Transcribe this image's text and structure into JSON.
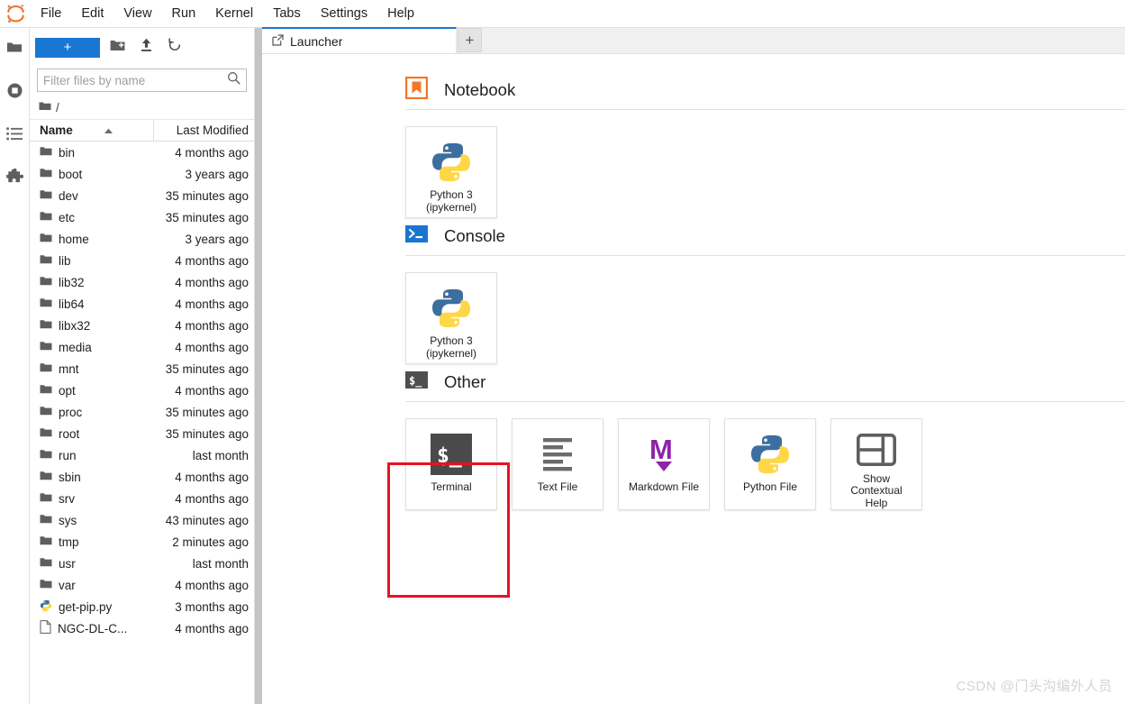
{
  "menubar": {
    "logo_icon": "jupyter-logo",
    "items": [
      {
        "label": "File"
      },
      {
        "label": "Edit"
      },
      {
        "label": "View"
      },
      {
        "label": "Run"
      },
      {
        "label": "Kernel"
      },
      {
        "label": "Tabs"
      },
      {
        "label": "Settings"
      },
      {
        "label": "Help"
      }
    ]
  },
  "activitybar": {
    "items": [
      {
        "name": "file-browser-icon",
        "label": "File Browser"
      },
      {
        "name": "running-terminals-icon",
        "label": "Running Terminals and Kernels"
      },
      {
        "name": "table-of-contents-icon",
        "label": "Table of Contents"
      },
      {
        "name": "extension-manager-icon",
        "label": "Extension Manager"
      }
    ]
  },
  "filebrowser": {
    "toolbar": {
      "new_label": "+",
      "new_folder_icon": "new-folder-icon",
      "upload_icon": "upload-icon",
      "refresh_icon": "refresh-icon"
    },
    "filter": {
      "placeholder": "Filter files by name",
      "value": "",
      "search_icon": "search-icon"
    },
    "breadcrumb": {
      "root_icon": "folder-icon",
      "path": "/"
    },
    "columns": {
      "name": "Name",
      "sort_icon": "sort-ascending-icon",
      "last_modified": "Last Modified"
    },
    "rows": [
      {
        "icon": "folder-icon",
        "name": "bin",
        "modified": "4 months ago"
      },
      {
        "icon": "folder-icon",
        "name": "boot",
        "modified": "3 years ago"
      },
      {
        "icon": "folder-icon",
        "name": "dev",
        "modified": "35 minutes ago"
      },
      {
        "icon": "folder-icon",
        "name": "etc",
        "modified": "35 minutes ago"
      },
      {
        "icon": "folder-icon",
        "name": "home",
        "modified": "3 years ago"
      },
      {
        "icon": "folder-icon",
        "name": "lib",
        "modified": "4 months ago"
      },
      {
        "icon": "folder-icon",
        "name": "lib32",
        "modified": "4 months ago"
      },
      {
        "icon": "folder-icon",
        "name": "lib64",
        "modified": "4 months ago"
      },
      {
        "icon": "folder-icon",
        "name": "libx32",
        "modified": "4 months ago"
      },
      {
        "icon": "folder-icon",
        "name": "media",
        "modified": "4 months ago"
      },
      {
        "icon": "folder-icon",
        "name": "mnt",
        "modified": "35 minutes ago"
      },
      {
        "icon": "folder-icon",
        "name": "opt",
        "modified": "4 months ago"
      },
      {
        "icon": "folder-icon",
        "name": "proc",
        "modified": "35 minutes ago"
      },
      {
        "icon": "folder-icon",
        "name": "root",
        "modified": "35 minutes ago"
      },
      {
        "icon": "folder-icon",
        "name": "run",
        "modified": "last month"
      },
      {
        "icon": "folder-icon",
        "name": "sbin",
        "modified": "4 months ago"
      },
      {
        "icon": "folder-icon",
        "name": "srv",
        "modified": "4 months ago"
      },
      {
        "icon": "folder-icon",
        "name": "sys",
        "modified": "43 minutes ago"
      },
      {
        "icon": "folder-icon",
        "name": "tmp",
        "modified": "2 minutes ago"
      },
      {
        "icon": "folder-icon",
        "name": "usr",
        "modified": "last month"
      },
      {
        "icon": "folder-icon",
        "name": "var",
        "modified": "4 months ago"
      },
      {
        "icon": "python-file-icon",
        "name": "get-pip.py",
        "modified": "3 months ago"
      },
      {
        "icon": "text-file-icon",
        "name": "NGC-DL-C...",
        "modified": "4 months ago"
      }
    ]
  },
  "maintabs": {
    "tabs": [
      {
        "label": "Launcher",
        "icon": "launcher-icon",
        "active": true
      }
    ],
    "add_label": "+"
  },
  "launcher": {
    "sections": [
      {
        "title": "Notebook",
        "icon": "notebook-bookmark-icon",
        "icon_color": "#f37726",
        "cards": [
          {
            "name": "python3-notebook-card",
            "icon": "python-logo-icon",
            "label": "Python 3\n(ipykernel)"
          }
        ]
      },
      {
        "title": "Console",
        "icon": "console-prompt-icon",
        "icon_color": "#1a75cf",
        "cards": [
          {
            "name": "python3-console-card",
            "icon": "python-logo-icon",
            "label": "Python 3\n(ipykernel)"
          }
        ]
      },
      {
        "title": "Other",
        "icon": "terminal-prompt-icon",
        "icon_color": "#4f4f4f",
        "cards": [
          {
            "name": "terminal-card",
            "icon": "terminal-icon",
            "label": "Terminal",
            "highlighted": true
          },
          {
            "name": "text-file-card",
            "icon": "text-lines-icon",
            "label": "Text File"
          },
          {
            "name": "markdown-file-card",
            "icon": "markdown-icon",
            "label": "Markdown File"
          },
          {
            "name": "python-file-card",
            "icon": "python-logo-icon",
            "label": "Python File"
          },
          {
            "name": "show-contextual-help-card",
            "icon": "panel-layout-icon",
            "label": "Show\nContextual\nHelp"
          }
        ]
      }
    ],
    "highlight_color": "#e81123"
  },
  "watermark": {
    "text": "CSDN @门头沟编外人员"
  }
}
